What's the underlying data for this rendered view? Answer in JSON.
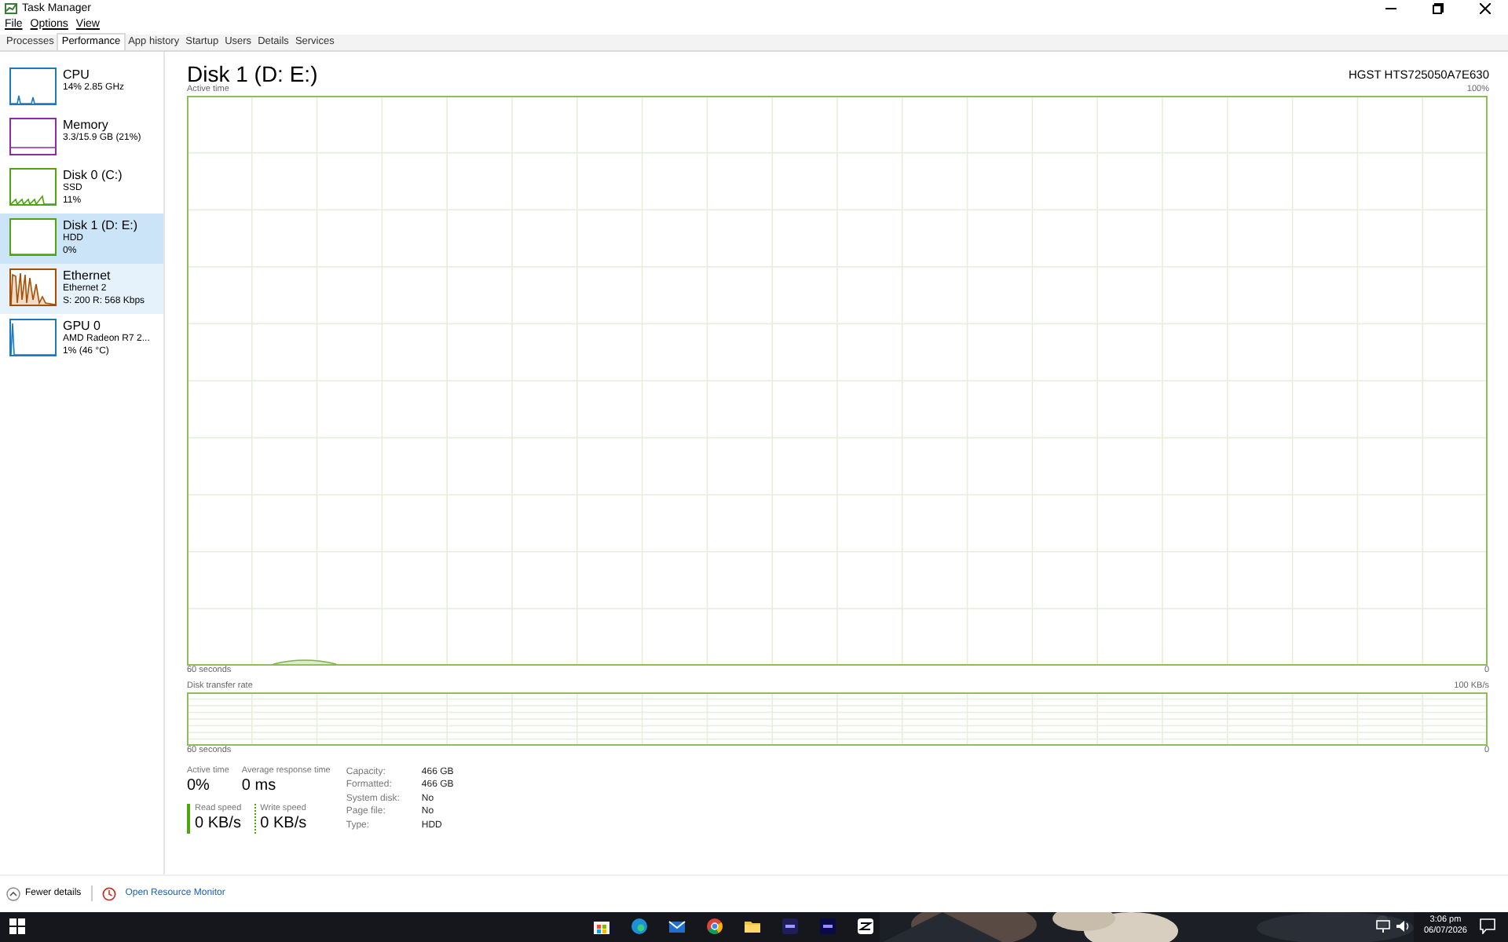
{
  "window": {
    "title": "Task Manager"
  },
  "menu": [
    "File",
    "Options",
    "View"
  ],
  "tabs": [
    {
      "label": "Processes",
      "selected": false
    },
    {
      "label": "Performance",
      "selected": true
    },
    {
      "label": "App history",
      "selected": false
    },
    {
      "label": "Startup",
      "selected": false
    },
    {
      "label": "Users",
      "selected": false
    },
    {
      "label": "Details",
      "selected": false
    },
    {
      "label": "Services",
      "selected": false
    }
  ],
  "sidebar": {
    "items": [
      {
        "name": "CPU",
        "lines": [
          "14% 2.85 GHz"
        ],
        "color": "#1c7ac1",
        "selected": false,
        "hovered": false
      },
      {
        "name": "Memory",
        "lines": [
          "3.3/15.9 GB (21%)"
        ],
        "color": "#8e2aa8",
        "selected": false,
        "hovered": false
      },
      {
        "name": "Disk 0 (C:)",
        "lines": [
          "SSD",
          "11%"
        ],
        "color": "#4da60c",
        "selected": false,
        "hovered": false
      },
      {
        "name": "Disk 1 (D: E:)",
        "lines": [
          "HDD",
          "0%"
        ],
        "color": "#4da60c",
        "selected": true,
        "hovered": false
      },
      {
        "name": "Ethernet",
        "lines": [
          "Ethernet 2",
          "S: 200 R: 568 Kbps"
        ],
        "color": "#a74f01",
        "selected": false,
        "hovered": true
      },
      {
        "name": "GPU 0",
        "lines": [
          "AMD Radeon R7 2...",
          "1% (46 °C)"
        ],
        "color": "#1c7ac1",
        "selected": false,
        "hovered": false
      }
    ]
  },
  "detail": {
    "title": "Disk 1 (D: E:)",
    "model": "HGST HTS725050A7E630",
    "active_chart": {
      "label": "Active time",
      "max": "100%",
      "span": "60 seconds",
      "min": "0"
    },
    "transfer_chart": {
      "label": "Disk transfer rate",
      "max": "100 KB/s",
      "span": "60 seconds",
      "min": "0"
    },
    "stats": [
      {
        "label": "Active time",
        "value": "0%"
      },
      {
        "label": "Average response time",
        "value": "0 ms"
      }
    ],
    "speeds": [
      {
        "label": "Read speed",
        "value": "0 KB/s",
        "kind": "read"
      },
      {
        "label": "Write speed",
        "value": "0 KB/s",
        "kind": "write"
      }
    ],
    "properties": [
      {
        "label": "Capacity:",
        "value": "466 GB"
      },
      {
        "label": "Formatted:",
        "value": "466 GB"
      },
      {
        "label": "System disk:",
        "value": "No"
      },
      {
        "label": "Page file:",
        "value": "No"
      },
      {
        "label": "Type:",
        "value": "HDD"
      }
    ]
  },
  "footer": {
    "fewer": "Fewer details",
    "monitor": "Open Resource Monitor"
  },
  "taskbar": {
    "time": "3:06 pm",
    "date": "06/07/2026"
  }
}
